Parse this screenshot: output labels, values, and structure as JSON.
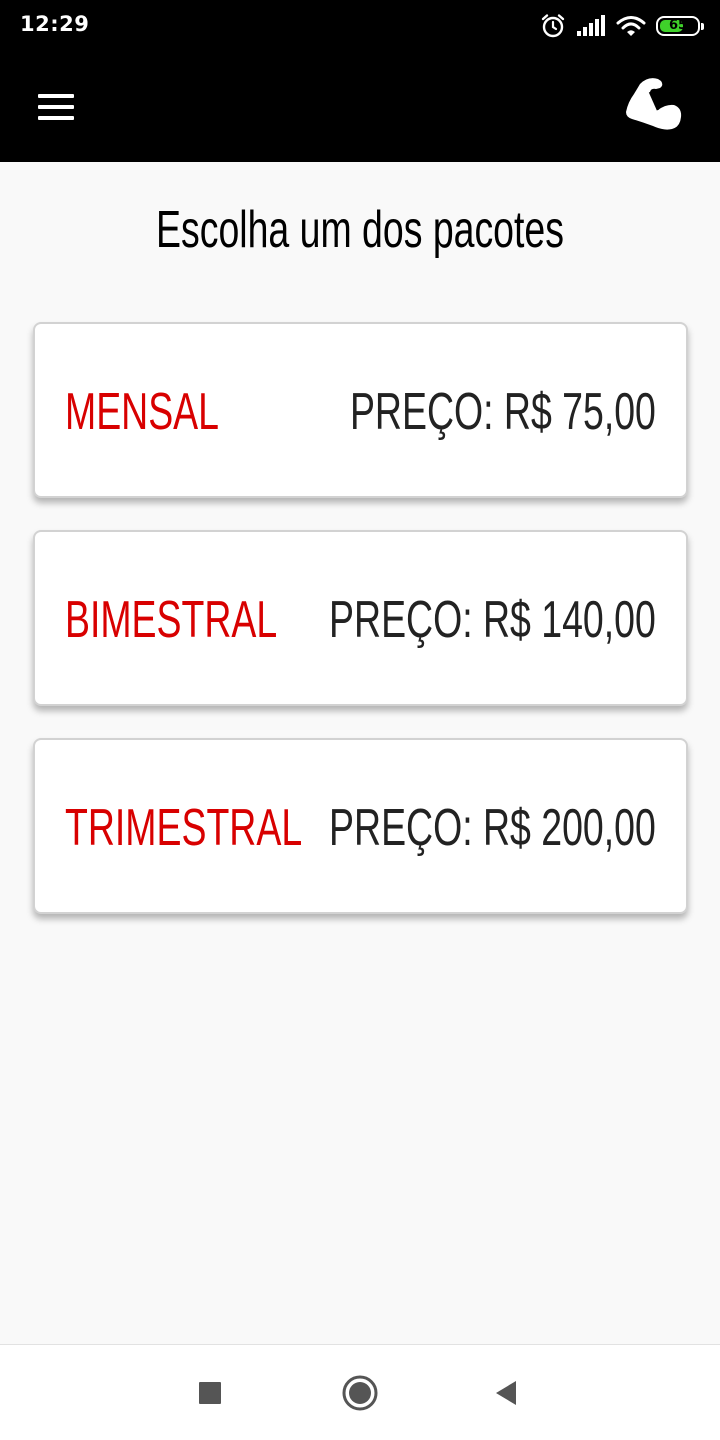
{
  "status_bar": {
    "time": "12:29",
    "battery_level": "65",
    "battery_fraction": 0.65,
    "icons": [
      "alarm-icon",
      "signal-icon",
      "wifi-icon",
      "battery-icon"
    ]
  },
  "app_bar": {
    "menu_icon": "hamburger-menu-icon",
    "logo_icon": "flexed-arm-icon"
  },
  "main": {
    "title": "Escolha um dos pacotes",
    "packages": [
      {
        "name": "MENSAL",
        "price": "PREÇO: R$ 75,00"
      },
      {
        "name": "BIMESTRAL",
        "price": "PREÇO: R$ 140,00"
      },
      {
        "name": "TRIMESTRAL",
        "price": "PREÇO: R$ 200,00"
      }
    ]
  },
  "nav_bar": {
    "buttons": [
      "recents-square-icon",
      "home-circle-icon",
      "back-triangle-icon"
    ]
  },
  "colors": {
    "accent_red": "#d80000",
    "price_text": "#222222",
    "bar_background": "#000000",
    "page_background": "#f9f9f9",
    "battery_green": "#3fd12a"
  }
}
